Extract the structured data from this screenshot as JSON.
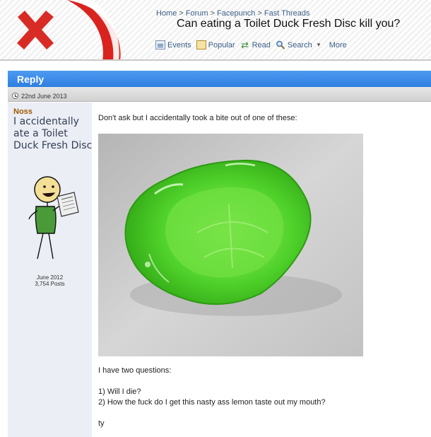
{
  "header": {
    "breadcrumb": [
      "Home",
      "Forum",
      "Facepunch",
      "Fast Threads"
    ],
    "breadcrumb_separator": ">",
    "thread_title": "Can eating a Toilet Duck Fresh Disc kill you?",
    "nav": [
      {
        "label": "Events",
        "icon": "calendar-icon"
      },
      {
        "label": "Popular",
        "icon": "popular-icon"
      },
      {
        "label": "Read",
        "icon": "read-arrow-icon"
      },
      {
        "label": "Search",
        "icon": "search-icon"
      },
      {
        "label": "More",
        "icon": "chevron-down-icon"
      }
    ],
    "logo_icon": "red-x-logo-icon"
  },
  "reply_bar": {
    "label": "Reply",
    "color": "#3b8ce9"
  },
  "date_bar": {
    "date": "22nd June 2013",
    "icon": "clock-icon"
  },
  "post": {
    "username": "Noss",
    "user_title": "I accidentally ate a Toilet Duck Fresh Disc",
    "avatar_icon": "stick-figure-reading-newspaper-avatar",
    "join_date": "June 2012",
    "post_count": "3,754 Posts",
    "lines": [
      "Don't ask but I accidentally took a bite out of one of these:",
      "I have two questions:",
      "1) Will I die?",
      "2) How the fuck do I get this nasty ass lemon taste out my mouth?",
      "ty"
    ],
    "image_description_icon": "green-gel-disc-photo"
  },
  "colors": {
    "accent_blue": "#3b8ce9",
    "username_orange": "#a05800",
    "link_blue": "#3b5f86",
    "sidebar_bg": "#ebeef4",
    "logo_red": "#d9231e"
  }
}
